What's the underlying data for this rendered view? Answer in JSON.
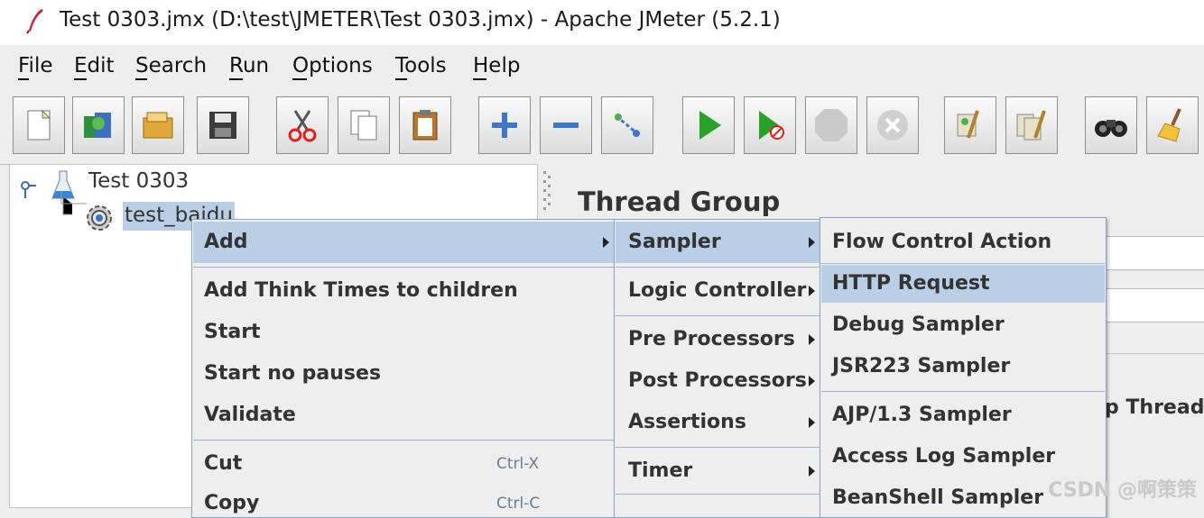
{
  "window": {
    "title": "Test 0303.jmx (D:\\test\\JMETER\\Test 0303.jmx) - Apache JMeter (5.2.1)"
  },
  "menubar": [
    {
      "label": "File"
    },
    {
      "label": "Edit"
    },
    {
      "label": "Search"
    },
    {
      "label": "Run"
    },
    {
      "label": "Options"
    },
    {
      "label": "Tools"
    },
    {
      "label": "Help"
    }
  ],
  "toolbar": [
    "new-icon",
    "templates-icon",
    "open-icon",
    "save-icon",
    "cut-icon",
    "copy-icon",
    "paste-icon",
    "expand-icon",
    "collapse-icon",
    "toggle-icon",
    "start-icon",
    "start-no-pauses-icon",
    "stop-icon",
    "shutdown-icon",
    "clear-icon",
    "clear-all-icon",
    "search-icon",
    "reset-search-icon"
  ],
  "tree": {
    "root": "Test 0303",
    "child": "test_baidu"
  },
  "panel": {
    "title": "Thread Group",
    "partial_text": "p Thread"
  },
  "context_menu": {
    "items": [
      {
        "label": "Add",
        "submenu": true
      },
      {
        "label": "Add Think Times to children"
      },
      {
        "label": "Start"
      },
      {
        "label": "Start no pauses"
      },
      {
        "label": "Validate"
      },
      {
        "label": "Cut",
        "accel": "Ctrl-X"
      },
      {
        "label": "Copy",
        "accel": "Ctrl-C"
      }
    ]
  },
  "add_submenu": {
    "items": [
      {
        "label": "Sampler"
      },
      {
        "label": "Logic Controller"
      },
      {
        "label": "Pre Processors"
      },
      {
        "label": "Post Processors"
      },
      {
        "label": "Assertions"
      },
      {
        "label": "Timer"
      }
    ]
  },
  "sampler_submenu": {
    "items": [
      {
        "label": "Flow Control Action"
      },
      {
        "label": "HTTP Request"
      },
      {
        "label": "Debug Sampler"
      },
      {
        "label": "JSR223 Sampler"
      },
      {
        "label": "AJP/1.3 Sampler"
      },
      {
        "label": "Access Log Sampler"
      },
      {
        "label": "BeanShell Sampler"
      }
    ]
  },
  "watermark": "CSDN @啊策策",
  "colors": {
    "selection": "#b8cfe5",
    "menu_border": "#8fa3bf"
  }
}
